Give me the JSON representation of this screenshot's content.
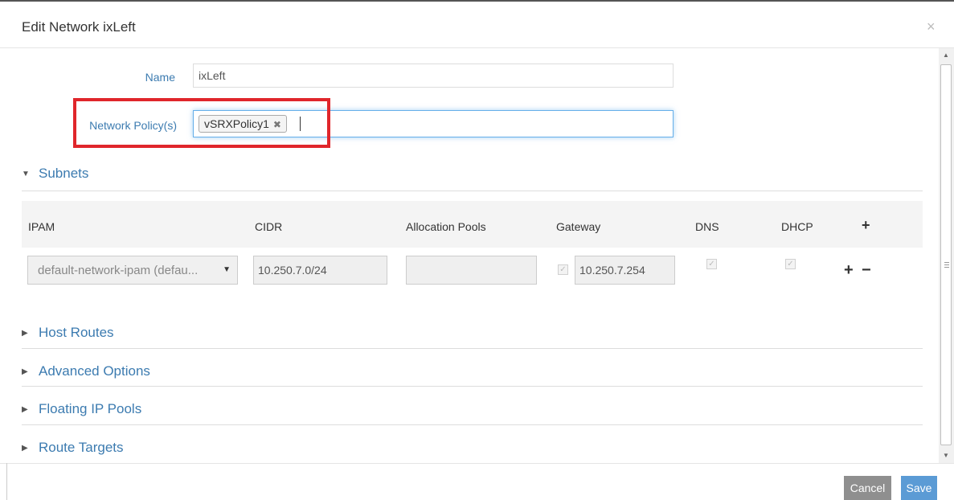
{
  "modal": {
    "title": "Edit Network ixLeft",
    "close_glyph": "×"
  },
  "form": {
    "name_label": "Name",
    "name_value": "ixLeft",
    "policy_label": "Network Policy(s)",
    "policy_tags": [
      "vSRXPolicy1"
    ],
    "tag_remove_glyph": "✖"
  },
  "sections": {
    "subnets": "Subnets",
    "host_routes": "Host Routes",
    "advanced_options": "Advanced Options",
    "floating_ip_pools": "Floating IP Pools",
    "route_targets": "Route Targets"
  },
  "subnet_table": {
    "columns": [
      "IPAM",
      "CIDR",
      "Allocation Pools",
      "Gateway",
      "DNS",
      "DHCP"
    ],
    "add_glyph": "+",
    "row": {
      "ipam": "default-network-ipam (defau...",
      "cidr": "10.250.7.0/24",
      "allocation_pools": "",
      "gateway": "10.250.7.254",
      "gateway_checked": true,
      "dns_checked": true,
      "dhcp_checked": true,
      "add_glyph": "+",
      "remove_glyph": "−"
    }
  },
  "footer": {
    "cancel_label": "Cancel",
    "save_label": "Save"
  },
  "colors": {
    "link_blue": "#3c7bb0",
    "highlight_red": "#e0262b",
    "save_blue": "#5b9bd5",
    "cancel_gray": "#8f8f8f"
  }
}
